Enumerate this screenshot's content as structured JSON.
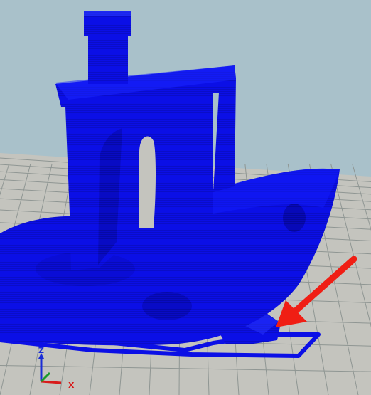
{
  "viewport": {
    "background_color": "#a9c1ca",
    "bed_color": "#c4c4be",
    "grid_line_color": "#8f9693",
    "model_color": "#0b0fe6",
    "model_shadow_color": "#06089e",
    "model_highlight_color": "#2a38ff"
  },
  "annotation": {
    "arrow_color": "#f01e14",
    "icon": "arrow-icon"
  },
  "axes": {
    "z_label": "Z",
    "x_label": "X",
    "z_color": "#1a2dd6",
    "x_color": "#d81b1b",
    "y_color": "#1a9a2a"
  }
}
